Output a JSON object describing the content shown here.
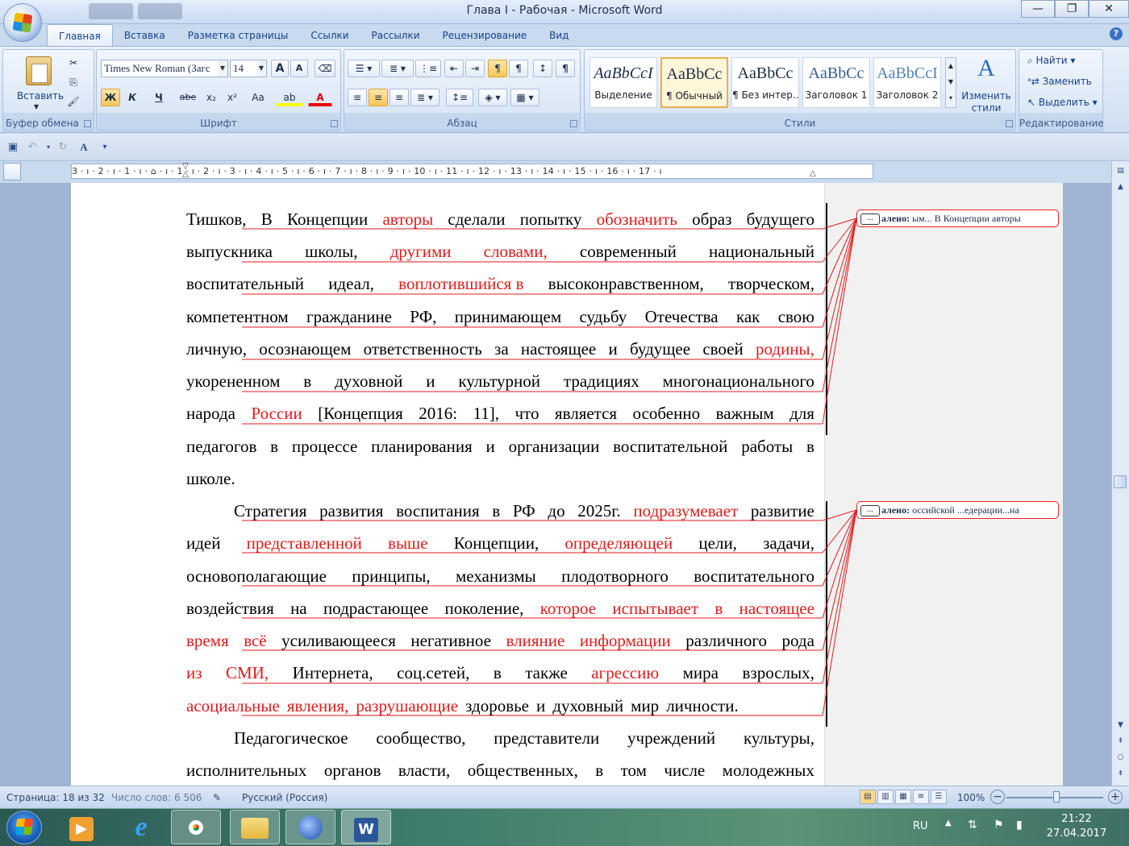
{
  "window": {
    "title": "Глава I - Рабочая - Microsoft Word",
    "minimize": "—",
    "maximize": "❐",
    "close": "✕"
  },
  "tabs": [
    "Главная",
    "Вставка",
    "Разметка страницы",
    "Ссылки",
    "Рассылки",
    "Рецензирование",
    "Вид"
  ],
  "ribbon": {
    "clipboard": {
      "paste": "Вставить",
      "label": "Буфер обмена"
    },
    "font": {
      "name": "Times New Roman (Загс",
      "size": "14",
      "label": "Шрифт",
      "bold": "Ж",
      "italic": "К",
      "underline": "Ч",
      "strike": "abe",
      "sub": "x₂",
      "sup": "x²",
      "case": "Aa",
      "grow": "A",
      "shrink": "A"
    },
    "paragraph": {
      "label": "Абзац"
    },
    "styles": {
      "label": "Стили",
      "items": [
        {
          "sample": "AaBbCcI",
          "name": "Выделение"
        },
        {
          "sample": "AaBbCc",
          "name": "¶ Обычный"
        },
        {
          "sample": "AaBbCc",
          "name": "¶ Без интер..."
        },
        {
          "sample": "AaBbCc",
          "name": "Заголовок 1"
        },
        {
          "sample": "AaBbCcI",
          "name": "Заголовок 2"
        }
      ],
      "change_styles": "Изменить стили"
    },
    "editing": {
      "label": "Редактирование",
      "find": "Найти",
      "replace": "Заменить",
      "select": "Выделить"
    }
  },
  "ruler": {
    "text": "3 · ı · 2 · ı · 1 · ı · ⌂ · ı · 1 · ı · 2 · ı · 3 · ı · 4 · ı · 5 · ı · 6 · ı · 7 · ı · 8 · ı · 9 · ı · 10 · ı · 11 · ı · 12 · ı · 13 · ı · 14 · ı · 15 · ı · 16 · ı · 17 · ı"
  },
  "document": {
    "lines": [
      [
        {
          "t": "Тишков,",
          "r": false
        },
        {
          "t": "В",
          "r": false
        },
        {
          "t": "Концепции",
          "r": false
        },
        {
          "t": "авторы",
          "r": true
        },
        {
          "t": "сделали",
          "r": false
        },
        {
          "t": "попытку",
          "r": false
        },
        {
          "t": "обозначить",
          "r": true
        },
        {
          "t": "образ",
          "r": false
        },
        {
          "t": "будущего",
          "r": false
        }
      ],
      [
        {
          "t": "выпускника",
          "r": false
        },
        {
          "t": "школы,",
          "r": false
        },
        {
          "t": "другими",
          "r": true
        },
        {
          "t": "словами,",
          "r": true
        },
        {
          "t": "современный",
          "r": false
        },
        {
          "t": "национальный",
          "r": false
        }
      ],
      [
        {
          "t": "воспитательный",
          "r": false
        },
        {
          "t": "идеал,",
          "r": false
        },
        {
          "t": "воплотившийся в",
          "r": true
        },
        {
          "t": "высоконравственном,",
          "r": false
        },
        {
          "t": "творческом,",
          "r": false
        }
      ],
      [
        {
          "t": "компетентном",
          "r": false
        },
        {
          "t": "гражданине",
          "r": false
        },
        {
          "t": "РФ,",
          "r": false
        },
        {
          "t": "принимающем",
          "r": false
        },
        {
          "t": "судьбу",
          "r": false
        },
        {
          "t": "Отечества",
          "r": false
        },
        {
          "t": "как",
          "r": false
        },
        {
          "t": "свою",
          "r": false
        }
      ],
      [
        {
          "t": "личную,",
          "r": false
        },
        {
          "t": "осознающем",
          "r": false
        },
        {
          "t": "ответственность",
          "r": false
        },
        {
          "t": "за",
          "r": false
        },
        {
          "t": "настоящее",
          "r": false
        },
        {
          "t": "и",
          "r": false
        },
        {
          "t": "будущее",
          "r": false
        },
        {
          "t": "своей",
          "r": false
        },
        {
          "t": "родины,",
          "r": true
        }
      ],
      [
        {
          "t": "укорененном",
          "r": false
        },
        {
          "t": "в",
          "r": false
        },
        {
          "t": "духовной",
          "r": false
        },
        {
          "t": "и",
          "r": false
        },
        {
          "t": "культурной",
          "r": false
        },
        {
          "t": "традициях",
          "r": false
        },
        {
          "t": "многонационального",
          "r": false
        }
      ],
      [
        {
          "t": "народа",
          "r": false
        },
        {
          "t": "России",
          "r": true
        },
        {
          "t": "[Концепция",
          "r": false
        },
        {
          "t": "2016:",
          "r": false
        },
        {
          "t": "11],",
          "r": false
        },
        {
          "t": "что",
          "r": false
        },
        {
          "t": "является",
          "r": false
        },
        {
          "t": "особенно",
          "r": false
        },
        {
          "t": "важным",
          "r": false
        },
        {
          "t": "для",
          "r": false
        }
      ],
      [
        {
          "t": "педагогов",
          "r": false
        },
        {
          "t": "в",
          "r": false
        },
        {
          "t": "процессе",
          "r": false
        },
        {
          "t": "планирования",
          "r": false
        },
        {
          "t": "и",
          "r": false
        },
        {
          "t": "организации",
          "r": false
        },
        {
          "t": "воспитательной",
          "r": false
        },
        {
          "t": "работы",
          "r": false
        },
        {
          "t": "в",
          "r": false
        }
      ],
      [
        {
          "t": "школе.",
          "r": false
        }
      ],
      [
        {
          "t": "Стратегия",
          "r": false
        },
        {
          "t": "развития",
          "r": false
        },
        {
          "t": "воспитания",
          "r": false
        },
        {
          "t": "в",
          "r": false
        },
        {
          "t": "РФ",
          "r": false
        },
        {
          "t": "до",
          "r": false
        },
        {
          "t": "2025г.",
          "r": false
        },
        {
          "t": "подразумевает",
          "r": true
        },
        {
          "t": "развитие",
          "r": false
        }
      ],
      [
        {
          "t": "идей",
          "r": false
        },
        {
          "t": "представленной",
          "r": true
        },
        {
          "t": "выше",
          "r": true
        },
        {
          "t": "Концепции,",
          "r": false
        },
        {
          "t": "определяющей",
          "r": true
        },
        {
          "t": "цели,",
          "r": false
        },
        {
          "t": "задачи,",
          "r": false
        }
      ],
      [
        {
          "t": "основополагающие",
          "r": false
        },
        {
          "t": "принципы,",
          "r": false
        },
        {
          "t": "механизмы",
          "r": false
        },
        {
          "t": "плодотворного",
          "r": false
        },
        {
          "t": "воспитательного",
          "r": false
        }
      ],
      [
        {
          "t": "воздействия",
          "r": false
        },
        {
          "t": "на",
          "r": false
        },
        {
          "t": "подрастающее",
          "r": false
        },
        {
          "t": "поколение,",
          "r": false
        },
        {
          "t": "которое",
          "r": true
        },
        {
          "t": "испытывает",
          "r": true
        },
        {
          "t": "в",
          "r": true
        },
        {
          "t": "настоящее",
          "r": true
        }
      ],
      [
        {
          "t": "время",
          "r": true
        },
        {
          "t": "всё",
          "r": true
        },
        {
          "t": "усиливающееся",
          "r": false
        },
        {
          "t": "негативное",
          "r": false
        },
        {
          "t": "влияние",
          "r": true
        },
        {
          "t": "информации",
          "r": true
        },
        {
          "t": "различного",
          "r": false
        },
        {
          "t": "рода",
          "r": false
        }
      ],
      [
        {
          "t": "из",
          "r": true
        },
        {
          "t": "СМИ,",
          "r": true
        },
        {
          "t": "Интернета,",
          "r": false
        },
        {
          "t": "соц.сетей,",
          "r": false
        },
        {
          "t": "в",
          "r": false
        },
        {
          "t": "также",
          "r": false
        },
        {
          "t": "агрессию",
          "r": true
        },
        {
          "t": "мира",
          "r": false
        },
        {
          "t": "взрослых,",
          "r": false
        }
      ],
      [
        {
          "t": "асоциальные",
          "r": true
        },
        {
          "t": "явления,",
          "r": true
        },
        {
          "t": "разрушающие",
          "r": true
        },
        {
          "t": "здоровье",
          "r": false
        },
        {
          "t": "и",
          "r": false
        },
        {
          "t": "духовный",
          "r": false
        },
        {
          "t": "мир",
          "r": false
        },
        {
          "t": "личности.",
          "r": false
        }
      ],
      [
        {
          "t": "Педагогическое",
          "r": false
        },
        {
          "t": "сообщество,",
          "r": false
        },
        {
          "t": "представители",
          "r": false
        },
        {
          "t": "учреждений",
          "r": false
        },
        {
          "t": "культуры,",
          "r": false
        }
      ],
      [
        {
          "t": "исполнительных",
          "r": false
        },
        {
          "t": "органов",
          "r": false
        },
        {
          "t": "власти,",
          "r": false
        },
        {
          "t": "общественных,",
          "r": false
        },
        {
          "t": "в",
          "r": false
        },
        {
          "t": "том",
          "r": false
        },
        {
          "t": "числе",
          "r": false
        },
        {
          "t": "молодежных",
          "r": false
        }
      ]
    ],
    "comments": [
      {
        "dots": "...",
        "label": "алено:",
        "text": "ым... В Концепции авторы"
      },
      {
        "dots": "...",
        "label": "алено:",
        "text": "оссийской ...едерации...на"
      }
    ]
  },
  "status": {
    "page": "Страница: 18 из 32",
    "words": "Число слов: 6 506",
    "language": "Русский (Россия)",
    "zoom": "100%"
  },
  "taskbar": {
    "lang": "RU",
    "time": "21:22",
    "date": "27.04.2017"
  }
}
